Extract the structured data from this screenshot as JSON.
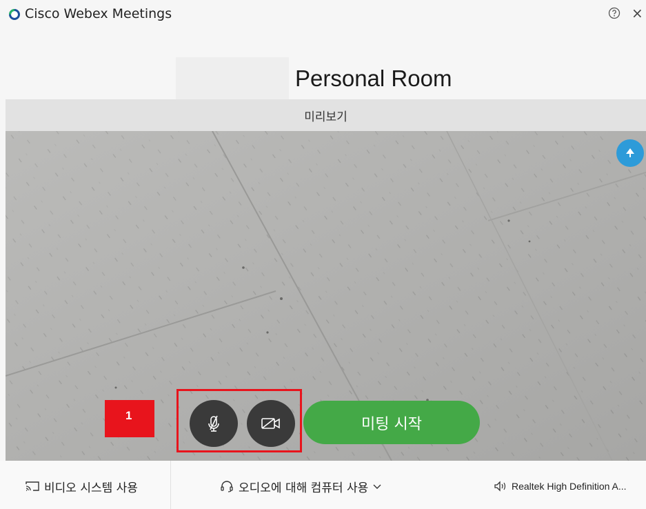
{
  "titlebar": {
    "app_title": "Cisco Webex Meetings",
    "help_icon": "question-circle-icon",
    "close_label": "×"
  },
  "header": {
    "room_title": "Personal Room"
  },
  "preview": {
    "label": "미리보기"
  },
  "controls": {
    "annotation_badge": "1",
    "mute_icon": "microphone-muted-icon",
    "video_icon": "video-off-icon",
    "start_label": "미팅 시작",
    "start_color": "#44a947",
    "highlight_color": "#e8141c"
  },
  "bottom": {
    "video_system_label": "비디오 시스템 사용",
    "audio_label": "오디오에 대해 컴퓨터 사용",
    "speaker_label": "Realtek High Definition A..."
  },
  "colors": {
    "share_button": "#2d9bd9"
  }
}
